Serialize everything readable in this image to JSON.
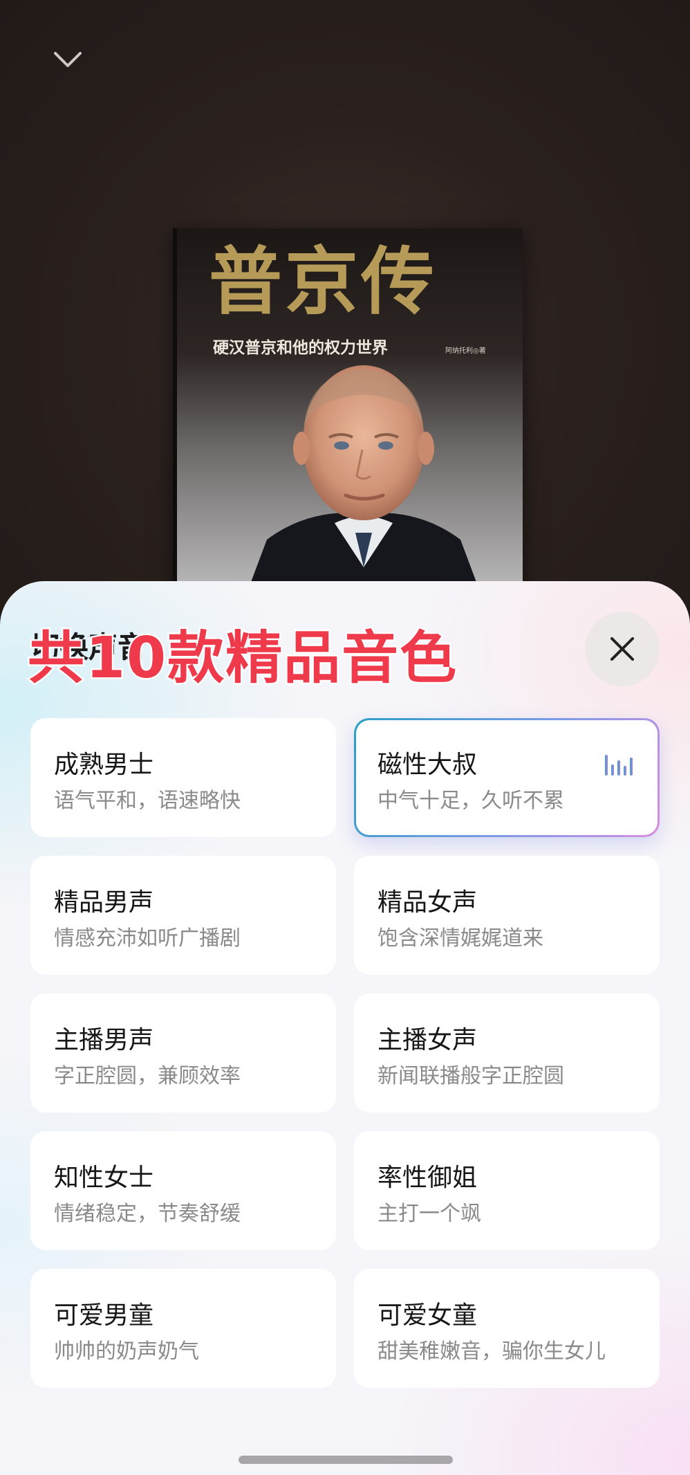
{
  "header": {
    "collapse_icon": "chevron-down-icon"
  },
  "book": {
    "title": "普京传",
    "subtitle": "硬汉普京和他的权力世界",
    "author": "阿纳托利◎著"
  },
  "sheet": {
    "title": "切换声音",
    "overlay_caption": "共10款精品音色",
    "close_icon": "close-icon",
    "accent_colors": [
      "#2a9fc4",
      "#7c9ae6",
      "#d88de0"
    ],
    "caption_color": "#ee3a4b"
  },
  "voices": [
    {
      "name": "成熟男士",
      "desc": "语气平和，语速略快",
      "selected": false
    },
    {
      "name": "磁性大叔",
      "desc": "中气十足，久听不累",
      "selected": true
    },
    {
      "name": "精品男声",
      "desc": "情感充沛如听广播剧",
      "selected": false
    },
    {
      "name": "精品女声",
      "desc": "饱含深情娓娓道来",
      "selected": false
    },
    {
      "name": "主播男声",
      "desc": "字正腔圆，兼顾效率",
      "selected": false
    },
    {
      "name": "主播女声",
      "desc": "新闻联播般字正腔圆",
      "selected": false
    },
    {
      "name": "知性女士",
      "desc": "情绪稳定，节奏舒缓",
      "selected": false
    },
    {
      "name": "率性御姐",
      "desc": "主打一个飒",
      "selected": false
    },
    {
      "name": "可爱男童",
      "desc": "帅帅的奶声奶气",
      "selected": false
    },
    {
      "name": "可爱女童",
      "desc": "甜美稚嫩音，骗你生女儿",
      "selected": false
    }
  ]
}
